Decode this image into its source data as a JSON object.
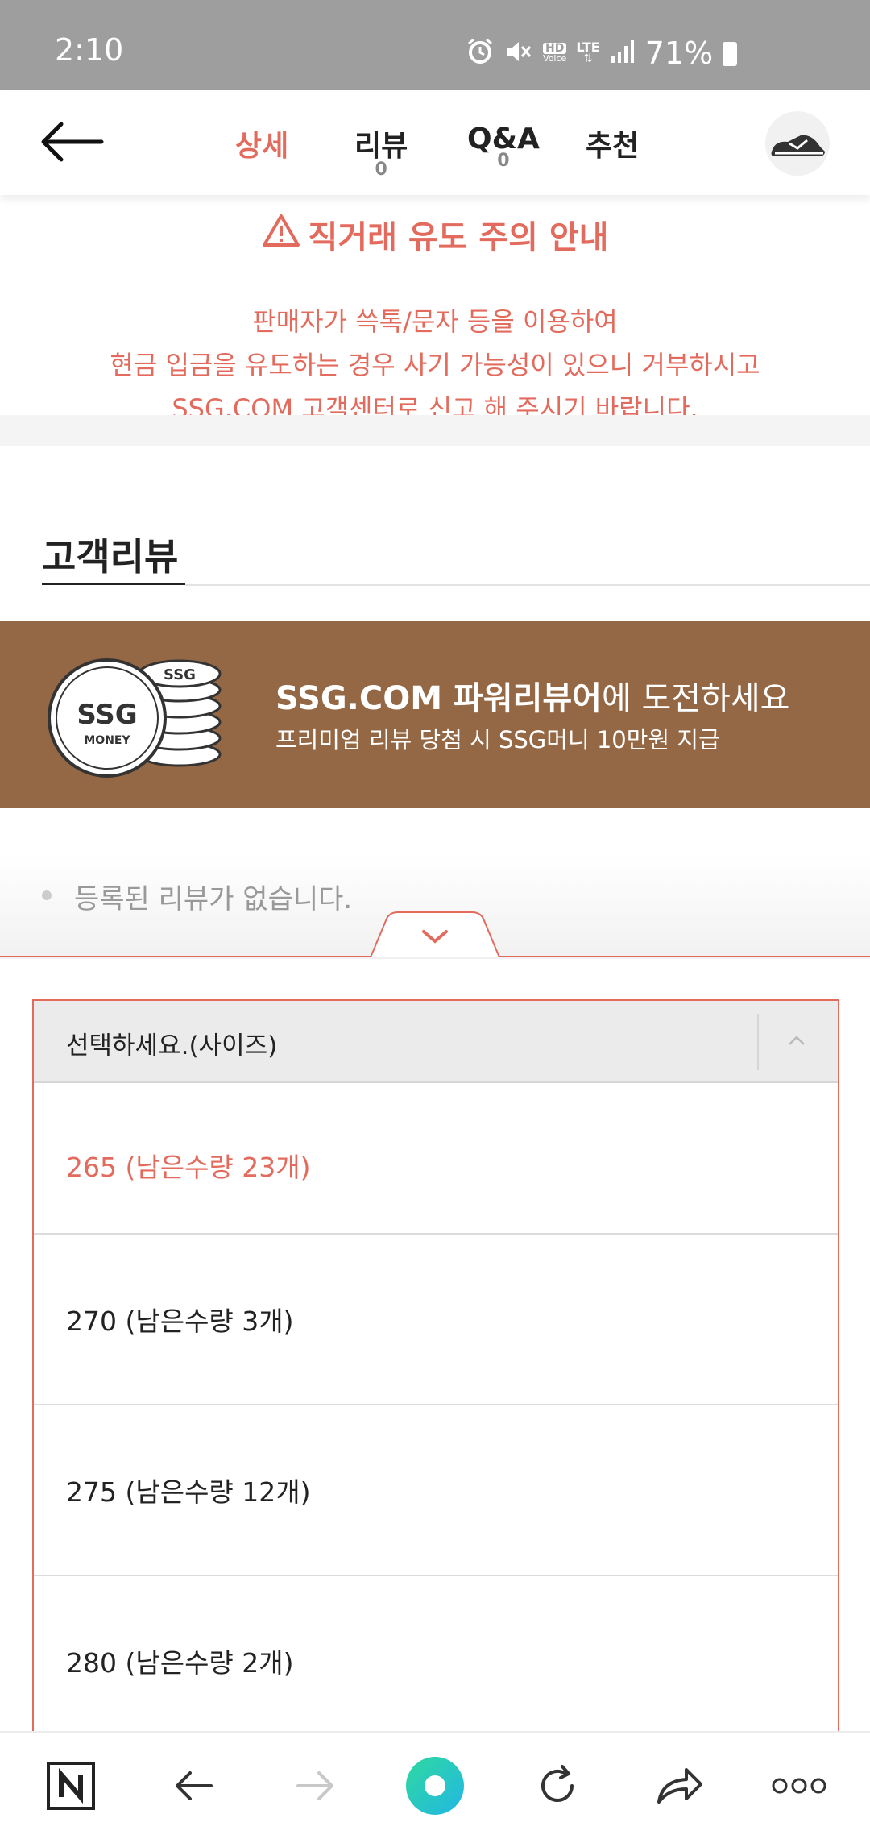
{
  "status_bar": {
    "time": "2:10",
    "battery": "71%",
    "icons": [
      "alarm-icon",
      "mute-icon",
      "hd-voice-icon",
      "lte-icon",
      "signal-icon",
      "battery-icon"
    ],
    "hd_label": "HD",
    "voice_label": "Voice",
    "lte_label": "LTE"
  },
  "header": {
    "tabs": [
      {
        "label": "상세",
        "count": null,
        "active": true
      },
      {
        "label": "리뷰",
        "count": "0",
        "active": false
      },
      {
        "label": "Q&A",
        "count": "0",
        "active": false
      },
      {
        "label": "추천",
        "count": null,
        "active": false
      }
    ]
  },
  "notice": {
    "title": "직거래 유도 주의 안내",
    "lines": [
      "판매자가 쓱톡/문자 등을 이용하여",
      "현금 입금을 유도하는 경우 사기 가능성이 있으니 거부하시고",
      "SSG.COM 고객센터로 신고 해 주시기 바랍니다."
    ]
  },
  "reviews": {
    "section_title": "고객리뷰",
    "banner": {
      "coin_big": "SSG",
      "coin_money": "MONEY",
      "coin_small": "SSG",
      "headline_bold": "SSG.COM 파워리뷰어",
      "headline_rest": "에 도전하세요",
      "sub": "프리미엄 리뷰 당첨 시 SSG머니 10만원 지급"
    },
    "empty_text": "등록된 리뷰가 없습니다."
  },
  "size_select": {
    "placeholder": "선택하세요.(사이즈)",
    "options": [
      "265 (남은수량 23개)",
      "270 (남은수량 3개)",
      "275 (남은수량 12개)",
      "280 (남은수량 2개)"
    ]
  },
  "colors": {
    "accent": "#e36b5d",
    "banner_bg": "#956845",
    "status_bar_bg": "#9e9e9e"
  }
}
